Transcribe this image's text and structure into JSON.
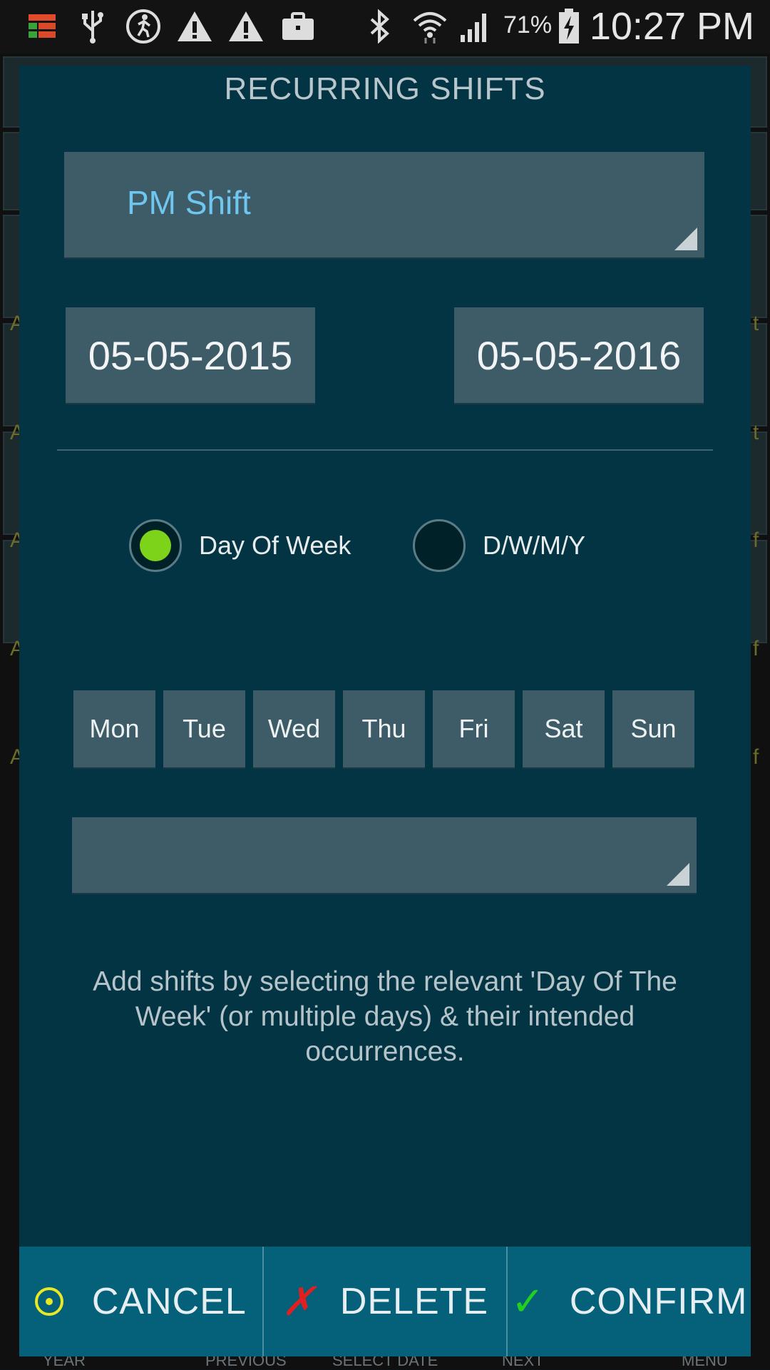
{
  "status_bar": {
    "battery_percent": "71%",
    "time": "10:27 PM",
    "icons": [
      "app-menu-icon",
      "usb-icon",
      "running-icon",
      "warning-icon",
      "warning-icon",
      "briefcase-icon",
      "bluetooth-icon",
      "wifi-icon",
      "signal-icon",
      "battery-charging-icon"
    ]
  },
  "background": {
    "row_letters": [
      "A",
      "A",
      "A",
      "A",
      "A"
    ],
    "row_right_letters": [
      "t",
      "t",
      "f",
      "f",
      "f"
    ],
    "bottom_nav": [
      "YEAR",
      "PREVIOUS",
      "SELECT DATE",
      "NEXT",
      "MENU"
    ]
  },
  "dialog": {
    "title": "RECURRING SHIFTS",
    "shift_spinner": {
      "value": "PM Shift"
    },
    "start_date": "05-05-2015",
    "end_date": "05-05-2016",
    "mode_options": [
      {
        "label": "Day Of Week",
        "selected": true
      },
      {
        "label": "D/W/M/Y",
        "selected": false
      }
    ],
    "days": [
      "Mon",
      "Tue",
      "Wed",
      "Thu",
      "Fri",
      "Sat",
      "Sun"
    ],
    "occurrence_spinner": {
      "value": ""
    },
    "help_text": "Add shifts by selecting the relevant 'Day Of The Week' (or multiple days) & their intended occurrences.",
    "actions": {
      "cancel": {
        "label": "CANCEL",
        "icon": "target-icon",
        "color": "#e8e823"
      },
      "delete": {
        "label": "DELETE",
        "icon": "x-icon",
        "color": "#e02020"
      },
      "confirm": {
        "label": "CONFIRM",
        "icon": "check-icon",
        "color": "#22d022"
      }
    }
  },
  "colors": {
    "dialog_bg": "#023444",
    "control_bg": "#3d5c67",
    "accent_blue": "#6fc6ef",
    "radio_selected": "#7dd21a",
    "action_bar": "#05607a"
  }
}
